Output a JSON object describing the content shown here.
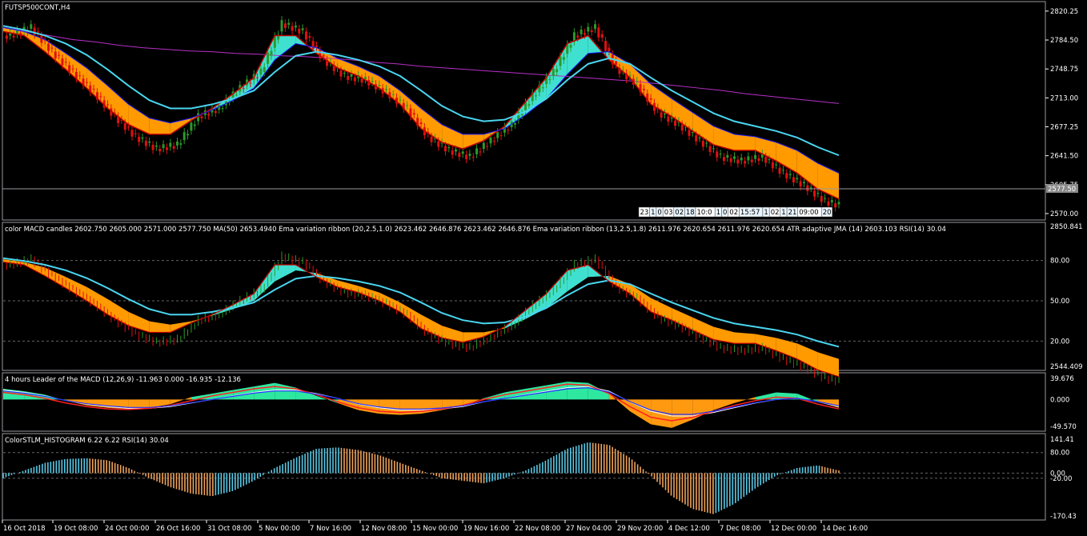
{
  "chart_data": [
    {
      "type": "line",
      "name": "main",
      "title": "FUTSP500CONT,H4",
      "ylim": [
        2565,
        2830
      ],
      "yticks": [
        2820.25,
        2784.5,
        2748.75,
        2713.0,
        2677.25,
        2641.5,
        2605.75,
        2570.0
      ],
      "ytick_labels": [
        "2820.25",
        "2784.50",
        "2748.75",
        "2713.00",
        "2677.25",
        "2641.50",
        "2605.75",
        "2570.00"
      ],
      "current_price_label": "2577.50",
      "time_labels": [
        "23",
        "1",
        "0",
        "03",
        "02",
        "18",
        "10:0",
        "1",
        "0",
        "02",
        "15:57",
        "1",
        "02",
        "1",
        "21",
        "09:00",
        "20"
      ],
      "close": [
        2790,
        2800,
        2770,
        2745,
        2720,
        2690,
        2665,
        2650,
        2655,
        2690,
        2700,
        2725,
        2745,
        2805,
        2795,
        2760,
        2740,
        2735,
        2720,
        2700,
        2665,
        2648,
        2640,
        2660,
        2680,
        2715,
        2745,
        2790,
        2800,
        2750,
        2730,
        2695,
        2680,
        2660,
        2640,
        2635,
        2640,
        2620,
        2605,
        2585,
        2578
      ],
      "ma50": [
        2800,
        2795,
        2790,
        2785,
        2782,
        2778,
        2775,
        2773,
        2771,
        2770,
        2768,
        2767,
        2765,
        2764,
        2762,
        2760,
        2757,
        2755,
        2752,
        2750,
        2748,
        2746,
        2744,
        2742,
        2740,
        2738,
        2736,
        2734,
        2731,
        2728,
        2725,
        2722,
        2718,
        2715,
        2712,
        2709,
        2706
      ],
      "ribbon_fast": [
        2795,
        2790,
        2770,
        2748,
        2725,
        2700,
        2680,
        2668,
        2668,
        2685,
        2700,
        2718,
        2738,
        2790,
        2790,
        2768,
        2750,
        2740,
        2725,
        2705,
        2675,
        2658,
        2650,
        2660,
        2678,
        2708,
        2738,
        2780,
        2790,
        2760,
        2738,
        2705,
        2690,
        2672,
        2655,
        2648,
        2648,
        2635,
        2620,
        2600,
        2588
      ],
      "ribbon_slow": [
        2800,
        2795,
        2785,
        2768,
        2750,
        2728,
        2705,
        2688,
        2682,
        2688,
        2698,
        2710,
        2725,
        2760,
        2780,
        2775,
        2762,
        2752,
        2740,
        2722,
        2700,
        2680,
        2668,
        2668,
        2675,
        2692,
        2712,
        2742,
        2768,
        2770,
        2755,
        2730,
        2712,
        2695,
        2678,
        2668,
        2665,
        2658,
        2648,
        2632,
        2620
      ],
      "jma": [
        2802,
        2797,
        2790,
        2780,
        2766,
        2748,
        2728,
        2710,
        2700,
        2700,
        2705,
        2712,
        2722,
        2745,
        2765,
        2770,
        2766,
        2760,
        2752,
        2740,
        2722,
        2703,
        2690,
        2684,
        2686,
        2696,
        2712,
        2735,
        2755,
        2762,
        2755,
        2738,
        2722,
        2708,
        2694,
        2684,
        2678,
        2672,
        2664,
        2652,
        2642
      ]
    },
    {
      "type": "line",
      "name": "color MACD candles",
      "legend": "color MACD candles 2602.750 2605.000 2571.000 2577.750 MA(50) 2653.4940 Ema variation ribbon (20,2.5,1.0) 2623.462 2646.876 2623.462 2646.876 Ema variation ribbon (13,2.5,1.8) 2611.976 2620.654 2611.976 2620.654 ATR adaptive JMA (14) 2603.103 RSI(14) 30.04",
      "ylim": [
        0,
        100
      ],
      "yticks": [
        80,
        50,
        20
      ],
      "ytick_labels": [
        "80.00",
        "50.00",
        "20.00"
      ],
      "scale_labels": [
        "2850.841",
        "2544.409"
      ]
    },
    {
      "type": "area",
      "name": "macd_leader",
      "legend": "4 hours Leader of the MACD (12,26,9) -11.963 0.000 -16.935 -12.136",
      "ylim": [
        -49.57,
        39.676
      ],
      "ytick_labels": [
        "39.676",
        "0.000",
        "-49.570"
      ],
      "hist": [
        18,
        14,
        8,
        -2,
        -10,
        -14,
        -16,
        -14,
        -8,
        4,
        10,
        16,
        22,
        28,
        20,
        6,
        -6,
        -18,
        -24,
        -26,
        -24,
        -18,
        -10,
        2,
        12,
        18,
        24,
        30,
        28,
        10,
        -20,
        -42,
        -48,
        -34,
        -18,
        -6,
        4,
        12,
        10,
        -4,
        -14
      ],
      "macd": [
        12,
        8,
        2,
        -6,
        -12,
        -16,
        -17,
        -15,
        -10,
        -2,
        6,
        12,
        18,
        22,
        18,
        8,
        -4,
        -14,
        -20,
        -22,
        -20,
        -16,
        -10,
        0,
        8,
        14,
        20,
        26,
        24,
        10,
        -12,
        -30,
        -36,
        -30,
        -20,
        -10,
        -2,
        4,
        2,
        -8,
        -16
      ],
      "signal": [
        16,
        12,
        6,
        -2,
        -8,
        -12,
        -15,
        -15,
        -12,
        -6,
        0,
        6,
        12,
        16,
        16,
        10,
        2,
        -8,
        -14,
        -18,
        -18,
        -16,
        -12,
        -4,
        2,
        8,
        14,
        20,
        22,
        14,
        -4,
        -20,
        -28,
        -28,
        -22,
        -14,
        -6,
        0,
        2,
        -4,
        -12
      ]
    },
    {
      "type": "bar",
      "name": "stlm_histogram",
      "legend": "ColorSTLM_HISTOGRAM 6.22 6.22 RSI(14) 30.04",
      "ylim": [
        -170.43,
        141.41
      ],
      "ytick_labels": [
        "141.41",
        "80.00",
        "0.00",
        "-20.00",
        "-170.43"
      ],
      "values": [
        -20,
        10,
        40,
        55,
        58,
        50,
        20,
        -20,
        -55,
        -80,
        -90,
        -70,
        -30,
        20,
        60,
        95,
        100,
        90,
        70,
        40,
        10,
        -20,
        -30,
        -40,
        -20,
        10,
        50,
        95,
        120,
        110,
        60,
        -10,
        -90,
        -140,
        -160,
        -120,
        -60,
        -10,
        20,
        30,
        10
      ],
      "positive_color": "#59c9e6",
      "negative_color": "#f0a35b"
    }
  ],
  "x_labels": [
    "16 Oct 2018",
    "19 Oct 08:00",
    "24 Oct 00:00",
    "26 Oct 16:00",
    "31 Oct 08:00",
    "5 Nov 00:00",
    "7 Nov 16:00",
    "12 Nov 08:00",
    "15 Nov 00:00",
    "19 Nov 16:00",
    "22 Nov 08:00",
    "27 Nov 04:00",
    "29 Nov 20:00",
    "4 Dec 12:00",
    "7 Dec 08:00",
    "12 Dec 00:00",
    "14 Dec 16:00"
  ],
  "colors": {
    "background": "#000000",
    "grid_line": "#9a9aa0",
    "ma50": "#b830c8",
    "ribbon_fill_down": "#ff9a00",
    "ribbon_fill_up": "#40e0d0",
    "jma": "#4ad6f0",
    "bull": "#2a9a2a",
    "bear": "#e01010",
    "macd_pos": "#2ee8a0",
    "macd_neg": "#ff9a10",
    "macd_line": "#ff2020",
    "signal_line": "#2030ff",
    "stlm_pos": "#59c9e6",
    "stlm_neg": "#f0a35b",
    "current_price_box": "#8a8a8a"
  }
}
